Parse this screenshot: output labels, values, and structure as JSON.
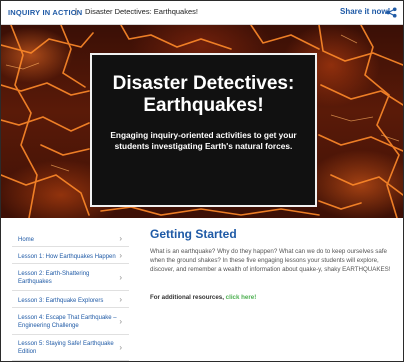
{
  "topbar": {
    "section": "INQUIRY IN ACTION",
    "separator": "|",
    "page_title": "Disaster Detectives: Earthquakes!",
    "share_label": "Share it now!"
  },
  "hero": {
    "title": "Disaster Detectives: Earthquakes!",
    "subtitle": "Engaging inquiry-oriented activities to get your students investigating Earth's natural forces."
  },
  "sidebar": {
    "items": [
      {
        "label": "Home"
      },
      {
        "label": "Lesson 1: How Earthquakes Happen"
      },
      {
        "label": "Lesson 2: Earth-Shattering Earthquakes"
      },
      {
        "label": "Lesson 3: Earthquake Explorers"
      },
      {
        "label": "Lesson 4: Escape That Earthquake – Engineering Challenge"
      },
      {
        "label": "Lesson 5: Staying Safe! Earthquake Edition"
      }
    ]
  },
  "main": {
    "title": "Getting Started",
    "body": "What is an earthquake? Why do they happen? What can we do to keep ourselves safe when the ground shakes? In these five engaging lessons your students will explore, discover, and remember a wealth of information about quake-y, shaky EARTHQUAKES!",
    "resources_prefix": "For additional resources,",
    "resources_link": "click here!"
  },
  "colors": {
    "accent_blue": "#1f5aa6",
    "link_green": "#4caf50",
    "lava": "#ff7a1a"
  },
  "icons": {
    "share": "share-icon"
  }
}
